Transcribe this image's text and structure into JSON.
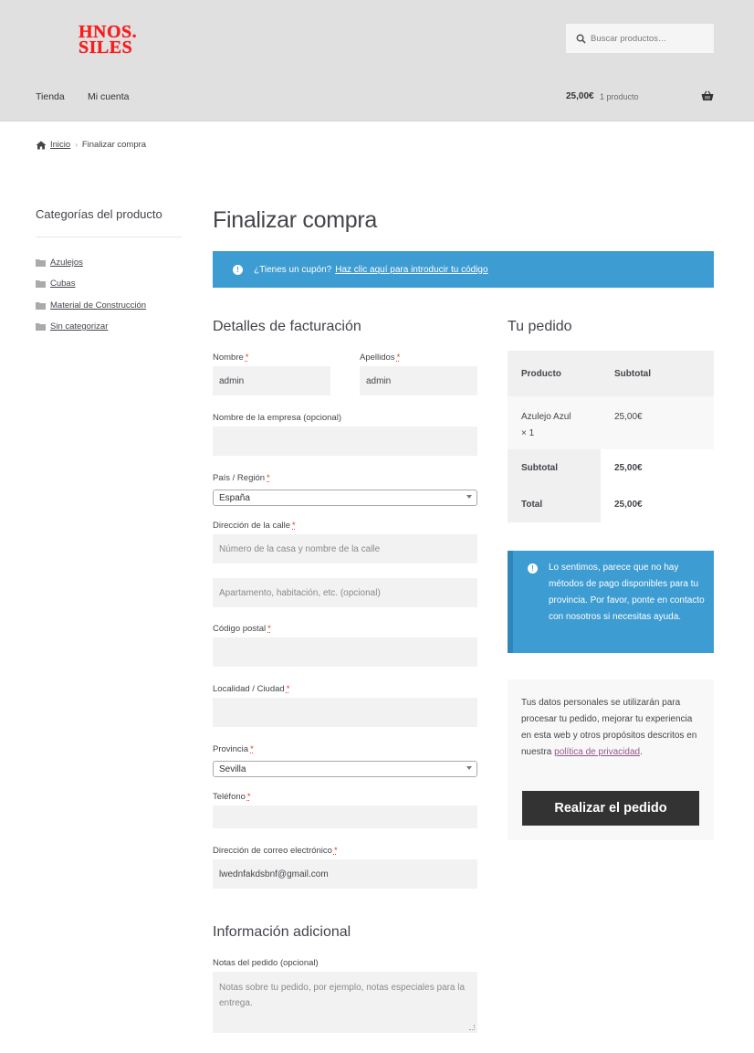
{
  "header": {
    "logo_text": "HNOS. SILES",
    "search_placeholder": "Buscar productos…",
    "nav": [
      "Tienda",
      "Mi cuenta"
    ],
    "cart_amount": "25,00€",
    "cart_count": "1 producto"
  },
  "breadcrumb": {
    "home": "Inicio",
    "current": "Finalizar compra"
  },
  "sidebar": {
    "title": "Categorías del producto",
    "categories": [
      "Azulejos",
      "Cubas",
      "Material de Construcción",
      "Sin categorizar"
    ]
  },
  "page_title": "Finalizar compra",
  "coupon": {
    "text": "¿Tienes un cupón?",
    "link": "Haz clic aquí para introducir tu código"
  },
  "billing": {
    "heading": "Detalles de facturación",
    "nombre_label": "Nombre",
    "nombre_value": "admin",
    "apellidos_label": "Apellidos",
    "apellidos_value": "admin",
    "empresa_label": "Nombre de la empresa (opcional)",
    "pais_label": "País / Región",
    "pais_value": "España",
    "direccion_label": "Dirección de la calle",
    "direccion_placeholder": "Número de la casa y nombre de la calle",
    "direccion2_placeholder": "Apartamento, habitación, etc. (opcional)",
    "cp_label": "Código postal",
    "localidad_label": "Localidad / Ciudad",
    "provincia_label": "Provincia",
    "provincia_value": "Sevilla",
    "telefono_label": "Teléfono",
    "email_label": "Dirección de correo electrónico",
    "email_value": "lwednfakdsbnf@gmail.com",
    "required_mark": "*"
  },
  "additional": {
    "heading": "Información adicional",
    "notes_label": "Notas del pedido (opcional)",
    "notes_placeholder": "Notas sobre tu pedido, por ejemplo, notas especiales para la entrega."
  },
  "order": {
    "heading": "Tu pedido",
    "col_product": "Producto",
    "col_subtotal": "Subtotal",
    "item_name": "Azulejo Azul",
    "item_qty": "× 1",
    "item_total": "25,00€",
    "subtotal_label": "Subtotal",
    "subtotal_value": "25,00€",
    "total_label": "Total",
    "total_value": "25,00€"
  },
  "payment_notice": "Lo sentimos, parece que no hay métodos de pago disponibles para tu provincia. Por favor, ponte en contacto con nosotros si necesitas ayuda.",
  "privacy": {
    "text": "Tus datos personales se utilizarán para procesar tu pedido, mejorar tu experiencia en esta web y otros propósitos descritos en nuestra",
    "link": "política de privacidad",
    "end": "."
  },
  "place_order": "Realizar el pedido",
  "colors": {
    "header_bg": "#e0e0e0",
    "info_blue": "#3d9cd2",
    "logo_red": "#ff1a1a",
    "button_dark": "#333333",
    "link_purple": "#96588a"
  }
}
